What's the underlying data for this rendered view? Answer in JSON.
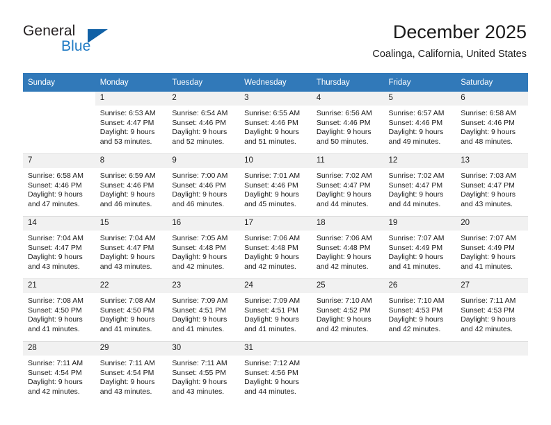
{
  "branding": {
    "name_part1": "General",
    "name_part2": "Blue",
    "triangle_color": "#1161a6",
    "blue_color": "#1f7ac4"
  },
  "header": {
    "title": "December 2025",
    "subtitle": "Coalinga, California, United States",
    "accent_color": "#3179b9"
  },
  "weekday_headers": [
    "Sunday",
    "Monday",
    "Tuesday",
    "Wednesday",
    "Thursday",
    "Friday",
    "Saturday"
  ],
  "weeks": [
    [
      {
        "day": "",
        "sunrise": "",
        "sunset": "",
        "daylight1": "",
        "daylight2": "",
        "blank": true
      },
      {
        "day": "1",
        "sunrise": "Sunrise: 6:53 AM",
        "sunset": "Sunset: 4:47 PM",
        "daylight1": "Daylight: 9 hours",
        "daylight2": "and 53 minutes."
      },
      {
        "day": "2",
        "sunrise": "Sunrise: 6:54 AM",
        "sunset": "Sunset: 4:46 PM",
        "daylight1": "Daylight: 9 hours",
        "daylight2": "and 52 minutes."
      },
      {
        "day": "3",
        "sunrise": "Sunrise: 6:55 AM",
        "sunset": "Sunset: 4:46 PM",
        "daylight1": "Daylight: 9 hours",
        "daylight2": "and 51 minutes."
      },
      {
        "day": "4",
        "sunrise": "Sunrise: 6:56 AM",
        "sunset": "Sunset: 4:46 PM",
        "daylight1": "Daylight: 9 hours",
        "daylight2": "and 50 minutes."
      },
      {
        "day": "5",
        "sunrise": "Sunrise: 6:57 AM",
        "sunset": "Sunset: 4:46 PM",
        "daylight1": "Daylight: 9 hours",
        "daylight2": "and 49 minutes."
      },
      {
        "day": "6",
        "sunrise": "Sunrise: 6:58 AM",
        "sunset": "Sunset: 4:46 PM",
        "daylight1": "Daylight: 9 hours",
        "daylight2": "and 48 minutes."
      }
    ],
    [
      {
        "day": "7",
        "sunrise": "Sunrise: 6:58 AM",
        "sunset": "Sunset: 4:46 PM",
        "daylight1": "Daylight: 9 hours",
        "daylight2": "and 47 minutes."
      },
      {
        "day": "8",
        "sunrise": "Sunrise: 6:59 AM",
        "sunset": "Sunset: 4:46 PM",
        "daylight1": "Daylight: 9 hours",
        "daylight2": "and 46 minutes."
      },
      {
        "day": "9",
        "sunrise": "Sunrise: 7:00 AM",
        "sunset": "Sunset: 4:46 PM",
        "daylight1": "Daylight: 9 hours",
        "daylight2": "and 46 minutes."
      },
      {
        "day": "10",
        "sunrise": "Sunrise: 7:01 AM",
        "sunset": "Sunset: 4:46 PM",
        "daylight1": "Daylight: 9 hours",
        "daylight2": "and 45 minutes."
      },
      {
        "day": "11",
        "sunrise": "Sunrise: 7:02 AM",
        "sunset": "Sunset: 4:47 PM",
        "daylight1": "Daylight: 9 hours",
        "daylight2": "and 44 minutes."
      },
      {
        "day": "12",
        "sunrise": "Sunrise: 7:02 AM",
        "sunset": "Sunset: 4:47 PM",
        "daylight1": "Daylight: 9 hours",
        "daylight2": "and 44 minutes."
      },
      {
        "day": "13",
        "sunrise": "Sunrise: 7:03 AM",
        "sunset": "Sunset: 4:47 PM",
        "daylight1": "Daylight: 9 hours",
        "daylight2": "and 43 minutes."
      }
    ],
    [
      {
        "day": "14",
        "sunrise": "Sunrise: 7:04 AM",
        "sunset": "Sunset: 4:47 PM",
        "daylight1": "Daylight: 9 hours",
        "daylight2": "and 43 minutes."
      },
      {
        "day": "15",
        "sunrise": "Sunrise: 7:04 AM",
        "sunset": "Sunset: 4:47 PM",
        "daylight1": "Daylight: 9 hours",
        "daylight2": "and 43 minutes."
      },
      {
        "day": "16",
        "sunrise": "Sunrise: 7:05 AM",
        "sunset": "Sunset: 4:48 PM",
        "daylight1": "Daylight: 9 hours",
        "daylight2": "and 42 minutes."
      },
      {
        "day": "17",
        "sunrise": "Sunrise: 7:06 AM",
        "sunset": "Sunset: 4:48 PM",
        "daylight1": "Daylight: 9 hours",
        "daylight2": "and 42 minutes."
      },
      {
        "day": "18",
        "sunrise": "Sunrise: 7:06 AM",
        "sunset": "Sunset: 4:48 PM",
        "daylight1": "Daylight: 9 hours",
        "daylight2": "and 42 minutes."
      },
      {
        "day": "19",
        "sunrise": "Sunrise: 7:07 AM",
        "sunset": "Sunset: 4:49 PM",
        "daylight1": "Daylight: 9 hours",
        "daylight2": "and 41 minutes."
      },
      {
        "day": "20",
        "sunrise": "Sunrise: 7:07 AM",
        "sunset": "Sunset: 4:49 PM",
        "daylight1": "Daylight: 9 hours",
        "daylight2": "and 41 minutes."
      }
    ],
    [
      {
        "day": "21",
        "sunrise": "Sunrise: 7:08 AM",
        "sunset": "Sunset: 4:50 PM",
        "daylight1": "Daylight: 9 hours",
        "daylight2": "and 41 minutes."
      },
      {
        "day": "22",
        "sunrise": "Sunrise: 7:08 AM",
        "sunset": "Sunset: 4:50 PM",
        "daylight1": "Daylight: 9 hours",
        "daylight2": "and 41 minutes."
      },
      {
        "day": "23",
        "sunrise": "Sunrise: 7:09 AM",
        "sunset": "Sunset: 4:51 PM",
        "daylight1": "Daylight: 9 hours",
        "daylight2": "and 41 minutes."
      },
      {
        "day": "24",
        "sunrise": "Sunrise: 7:09 AM",
        "sunset": "Sunset: 4:51 PM",
        "daylight1": "Daylight: 9 hours",
        "daylight2": "and 41 minutes."
      },
      {
        "day": "25",
        "sunrise": "Sunrise: 7:10 AM",
        "sunset": "Sunset: 4:52 PM",
        "daylight1": "Daylight: 9 hours",
        "daylight2": "and 42 minutes."
      },
      {
        "day": "26",
        "sunrise": "Sunrise: 7:10 AM",
        "sunset": "Sunset: 4:53 PM",
        "daylight1": "Daylight: 9 hours",
        "daylight2": "and 42 minutes."
      },
      {
        "day": "27",
        "sunrise": "Sunrise: 7:11 AM",
        "sunset": "Sunset: 4:53 PM",
        "daylight1": "Daylight: 9 hours",
        "daylight2": "and 42 minutes."
      }
    ],
    [
      {
        "day": "28",
        "sunrise": "Sunrise: 7:11 AM",
        "sunset": "Sunset: 4:54 PM",
        "daylight1": "Daylight: 9 hours",
        "daylight2": "and 42 minutes."
      },
      {
        "day": "29",
        "sunrise": "Sunrise: 7:11 AM",
        "sunset": "Sunset: 4:54 PM",
        "daylight1": "Daylight: 9 hours",
        "daylight2": "and 43 minutes."
      },
      {
        "day": "30",
        "sunrise": "Sunrise: 7:11 AM",
        "sunset": "Sunset: 4:55 PM",
        "daylight1": "Daylight: 9 hours",
        "daylight2": "and 43 minutes."
      },
      {
        "day": "31",
        "sunrise": "Sunrise: 7:12 AM",
        "sunset": "Sunset: 4:56 PM",
        "daylight1": "Daylight: 9 hours",
        "daylight2": "and 44 minutes."
      },
      {
        "day": "",
        "sunrise": "",
        "sunset": "",
        "daylight1": "",
        "daylight2": "",
        "empty": true
      },
      {
        "day": "",
        "sunrise": "",
        "sunset": "",
        "daylight1": "",
        "daylight2": "",
        "empty": true
      },
      {
        "day": "",
        "sunrise": "",
        "sunset": "",
        "daylight1": "",
        "daylight2": "",
        "empty": true
      }
    ]
  ]
}
